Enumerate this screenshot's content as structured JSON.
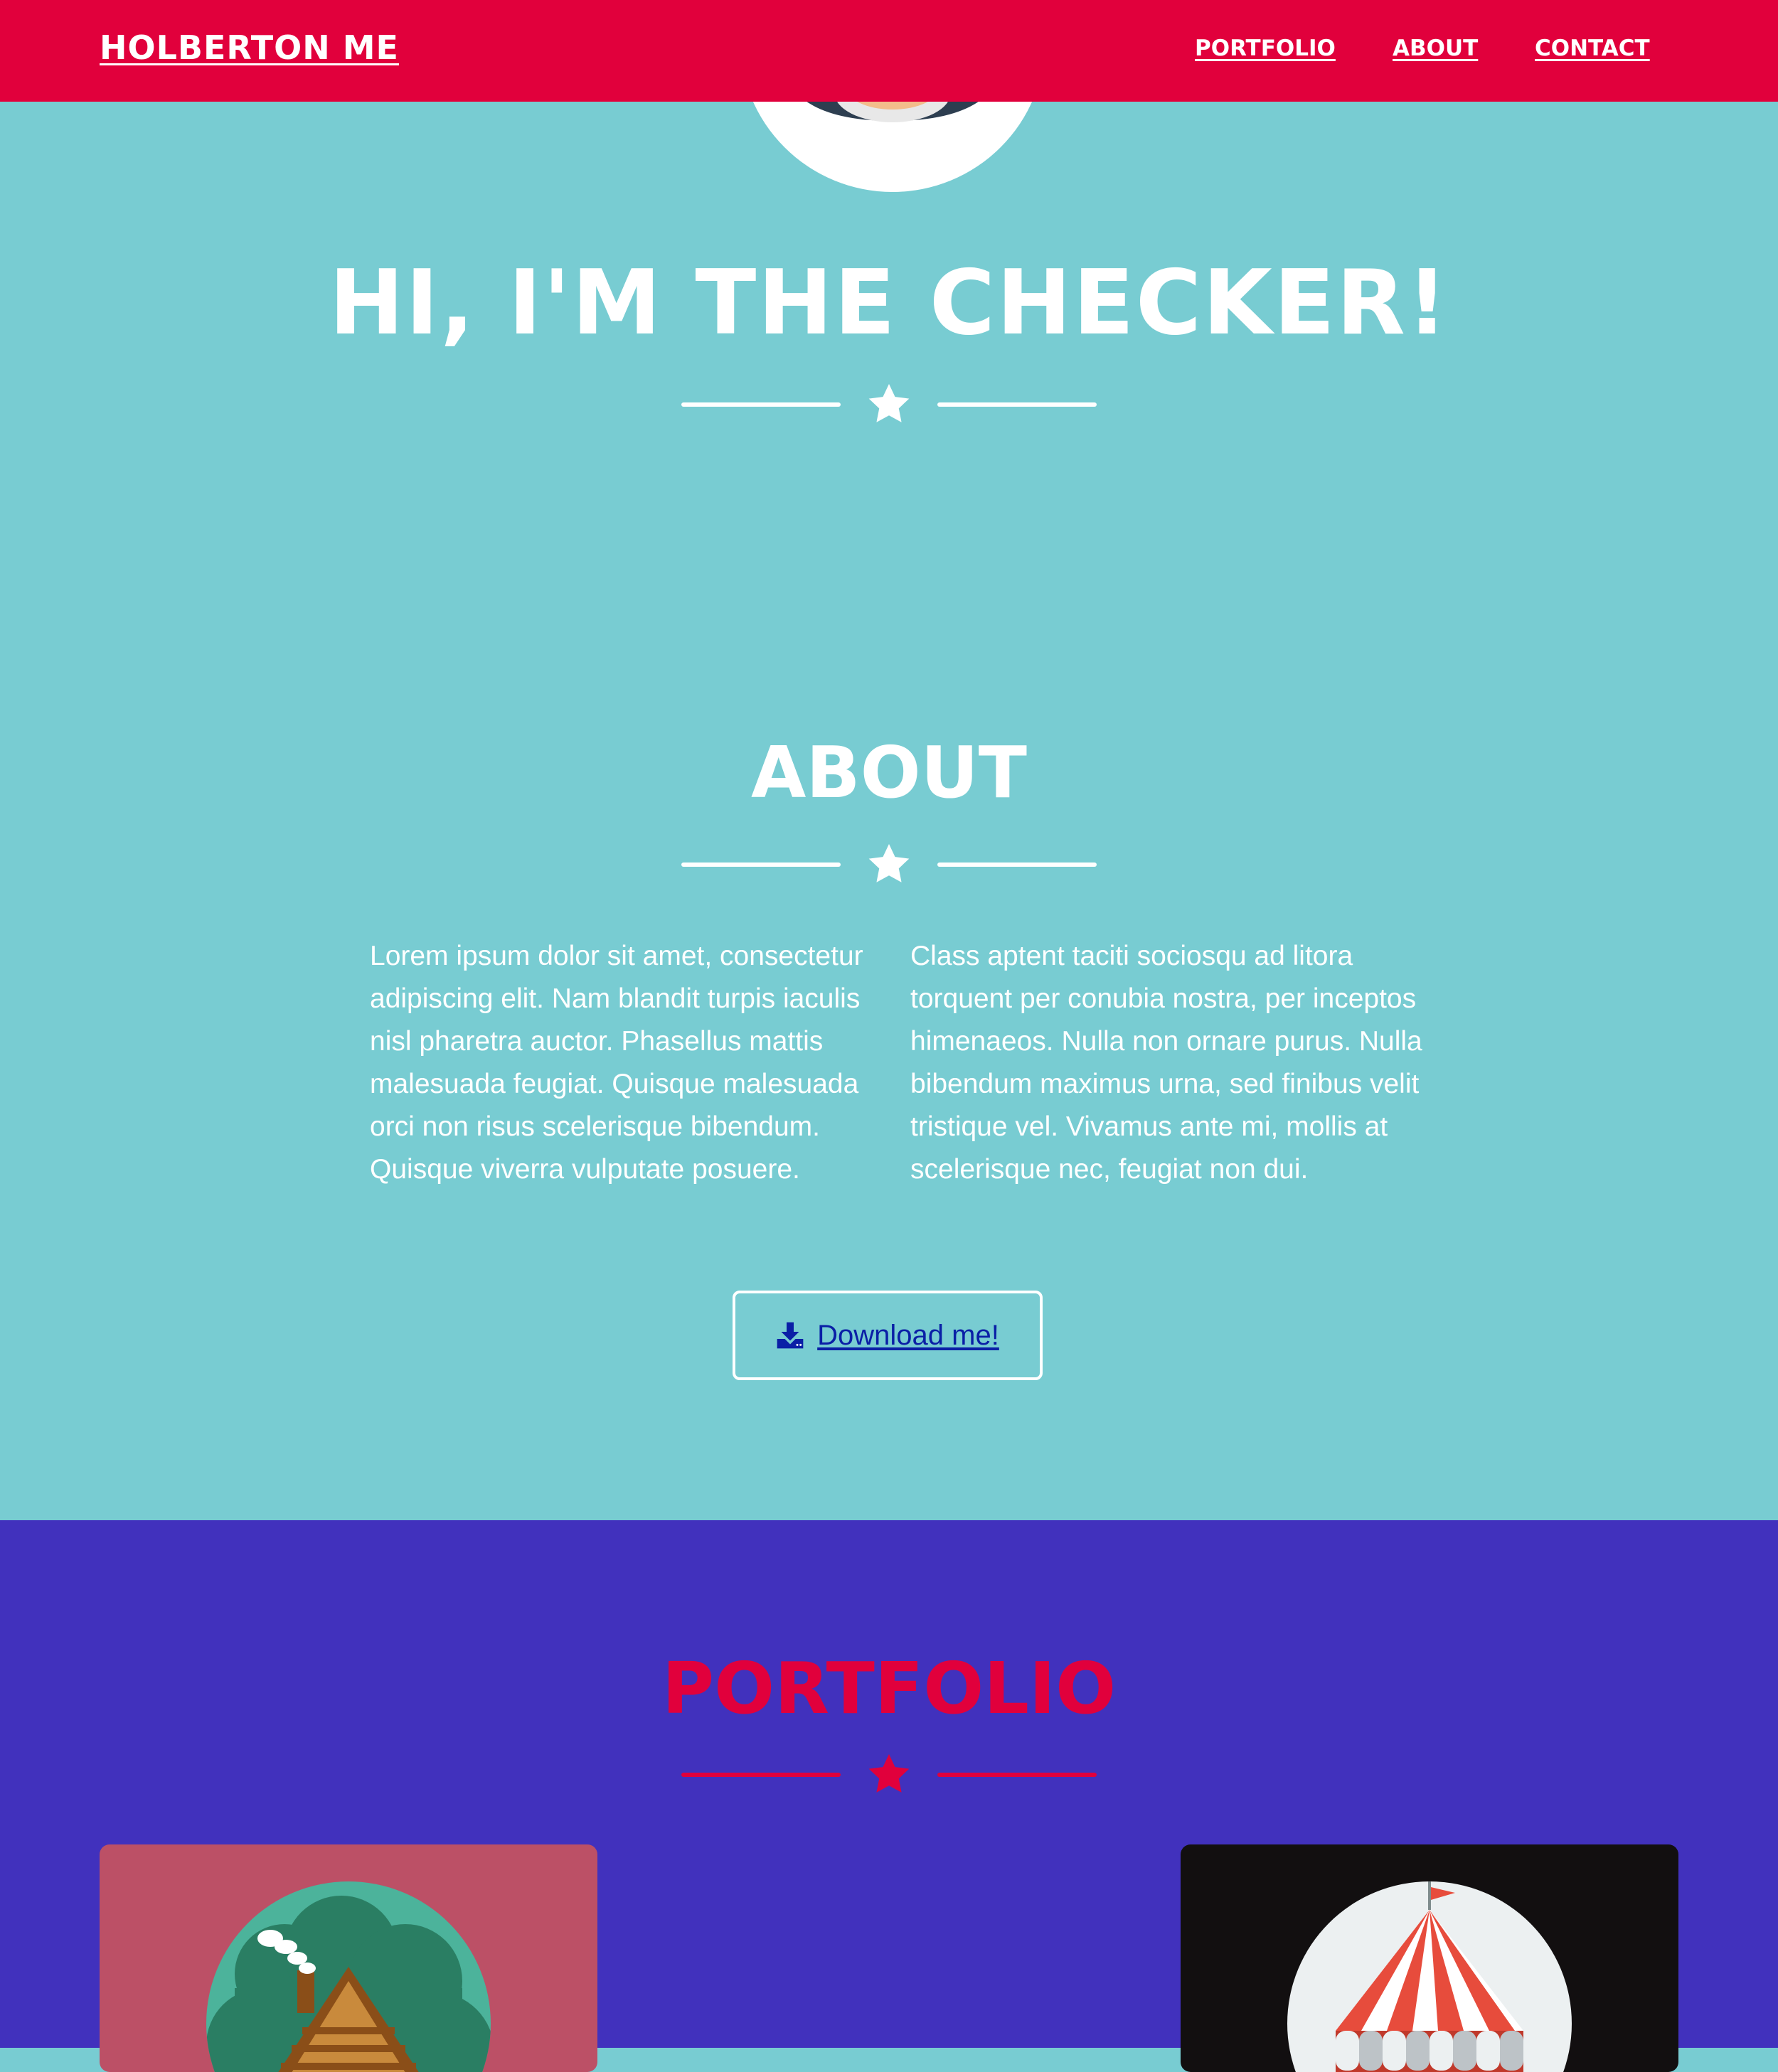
{
  "navbar": {
    "brand": "HOLBERTON ME",
    "links": [
      "PORTFOLIO",
      "ABOUT",
      "CONTACT"
    ],
    "background_color": "#e1003c"
  },
  "hero": {
    "title": "HI, I'M THE CHECKER!",
    "avatar_icon": "avatar-icon",
    "divider_icon": "star-icon"
  },
  "about": {
    "title": "ABOUT",
    "paragraphs": [
      "Lorem ipsum dolor sit amet, consectetur adipiscing elit. Nam blandit turpis iaculis nisl pharetra auctor. Phasellus mattis malesuada feugiat. Quisque malesuada orci non risus scelerisque bibendum. Quisque viverra vulputate posuere.",
      "Class aptent taciti sociosqu ad litora torquent per conubia nostra, per inceptos himenaeos. Nulla non ornare purus. Nulla bibendum maximus urna, sed finibus velit tristique vel. Vivamus ante mi, mollis at scelerisque nec, feugiat non dui."
    ],
    "download_button": {
      "label": " Download me!",
      "icon": "download-icon"
    },
    "background_color": "#78ccd2"
  },
  "portfolio": {
    "title": "PORTFOLIO",
    "background_color": "#4131bd",
    "accent_color": "#e1003c",
    "items": [
      {
        "icon": "cabin-icon",
        "background_color": "#bc5066"
      },
      {
        "icon": "circus-tent-icon",
        "background_color": "#120f10"
      }
    ]
  }
}
